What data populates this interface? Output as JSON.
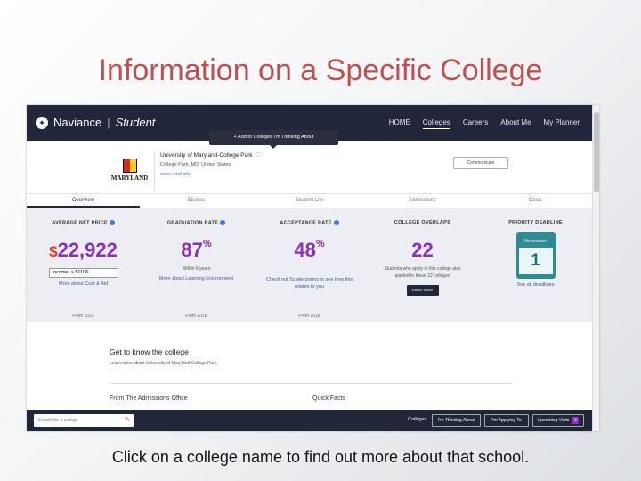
{
  "slide": {
    "title": "Information on a Specific College",
    "caption": "Click on a college name to find out more about that school."
  },
  "navbar": {
    "brand": "Naviance",
    "brand_sub": "Student",
    "links": [
      "HOME",
      "Colleges",
      "Careers",
      "About Me",
      "My Planner"
    ],
    "active_link": "Colleges"
  },
  "tooltip": "+ Add to Colleges I'm Thinking About",
  "college": {
    "logo_text": "MARYLAND",
    "name": "University of Maryland-College Park",
    "location": "College Park, MD, United States",
    "url": "www.umd.edu",
    "communicate_label": "Communicate"
  },
  "tabs": [
    "Overview",
    "Studies",
    "Student Life",
    "Admissions",
    "Costs"
  ],
  "stats": {
    "net_price": {
      "label": "AVERAGE NET PRICE",
      "currency": "$",
      "value": "22,922",
      "income_select": "Income: > $110K",
      "link": "More about Cost & Aid",
      "from": "From 2015"
    },
    "graduation": {
      "label": "GRADUATION RATE",
      "value": "87",
      "unit": "%",
      "sub": "Within 6 years",
      "link": "More about Learning Environment",
      "from": "From 2018"
    },
    "acceptance": {
      "label": "ACCEPTANCE RATE",
      "value": "48",
      "unit": "%",
      "link": "Check out Scattergrams to see how this relates to you",
      "from": "From 2018"
    },
    "overlaps": {
      "label": "COLLEGE OVERLAPS",
      "value": "22",
      "sub": "Students who apply to this college also applied to these 22 colleges",
      "button": "Learn more"
    },
    "deadline": {
      "label": "PRIORITY DEADLINE",
      "month": "November",
      "day": "1",
      "link": "See all deadlines"
    }
  },
  "main": {
    "know_title": "Get to know the college",
    "know_sub": "Learn more about University of Maryland College Park.",
    "from_admissions": "From The Admissions Office",
    "quick_facts": "Quick Facts"
  },
  "bottombar": {
    "search_placeholder": "Search for a college",
    "colleges_label": "Colleges",
    "thinking": "I'm Thinking About",
    "applying": "I'm Applying To",
    "visits": "Upcoming Visits",
    "visits_count": "3"
  }
}
